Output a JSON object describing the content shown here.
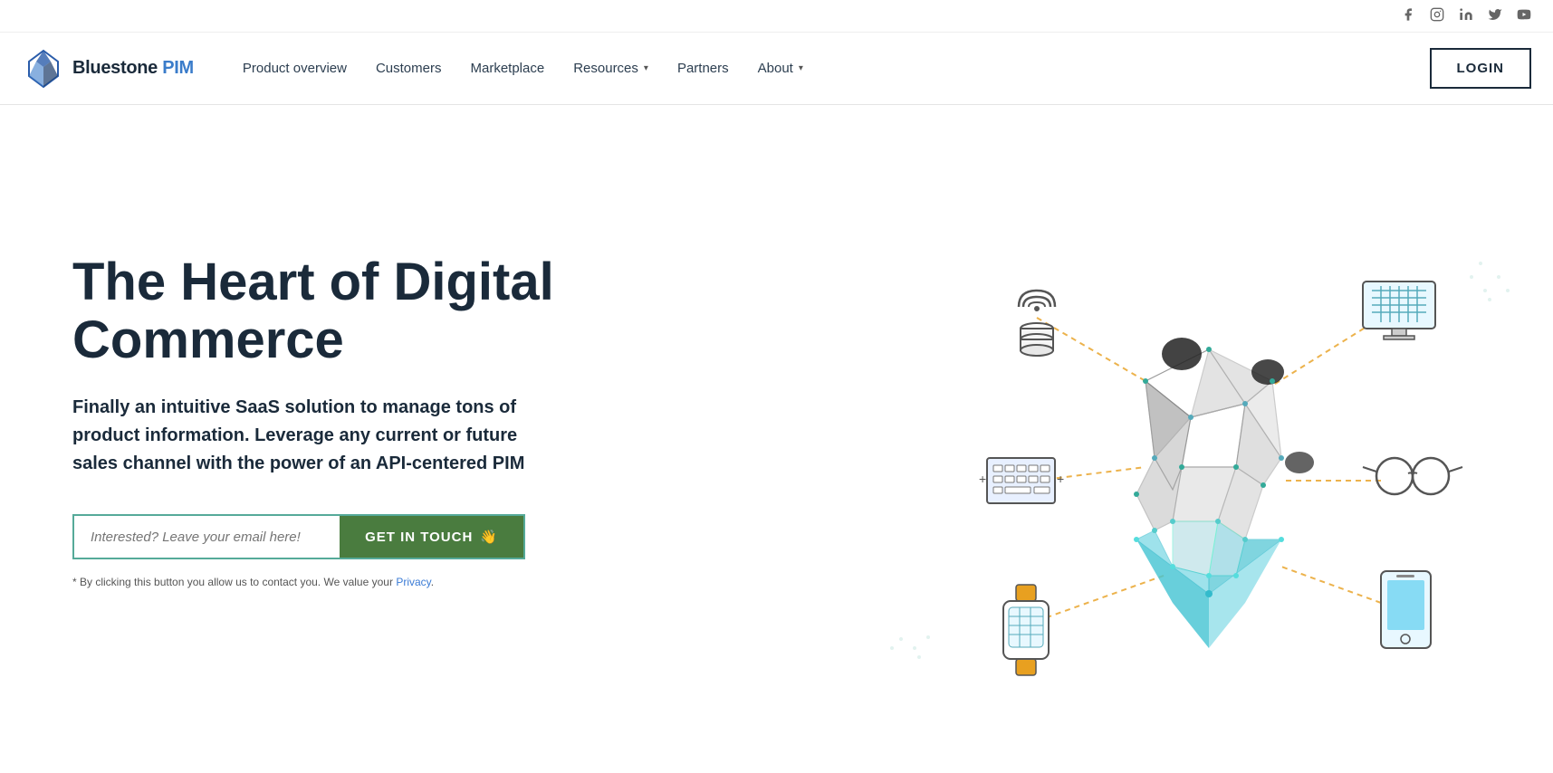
{
  "social": {
    "icons": [
      "facebook",
      "instagram",
      "linkedin",
      "twitter",
      "youtube"
    ]
  },
  "logo": {
    "name": "Bluestone PIM",
    "brand": "Bluestone",
    "type": " PIM"
  },
  "nav": {
    "items": [
      {
        "label": "Product overview",
        "hasDropdown": false
      },
      {
        "label": "Customers",
        "hasDropdown": false
      },
      {
        "label": "Marketplace",
        "hasDropdown": false
      },
      {
        "label": "Resources",
        "hasDropdown": true
      },
      {
        "label": "Partners",
        "hasDropdown": false
      },
      {
        "label": "About",
        "hasDropdown": true
      }
    ],
    "loginLabel": "LOGIN"
  },
  "hero": {
    "title": "The Heart of Digital Commerce",
    "subtitle": "Finally an intuitive SaaS solution to manage tons of product information. Leverage any current or future sales channel with the power of an API-centered PIM",
    "emailPlaceholder": "Interested? Leave your email here!",
    "ctaLabel": "GET IN TOUCH",
    "ctaEmoji": "👋",
    "privacyNote": "* By clicking this button you allow us to contact you. We value your",
    "privacyLinkLabel": "Privacy",
    "privacyEnd": "."
  }
}
